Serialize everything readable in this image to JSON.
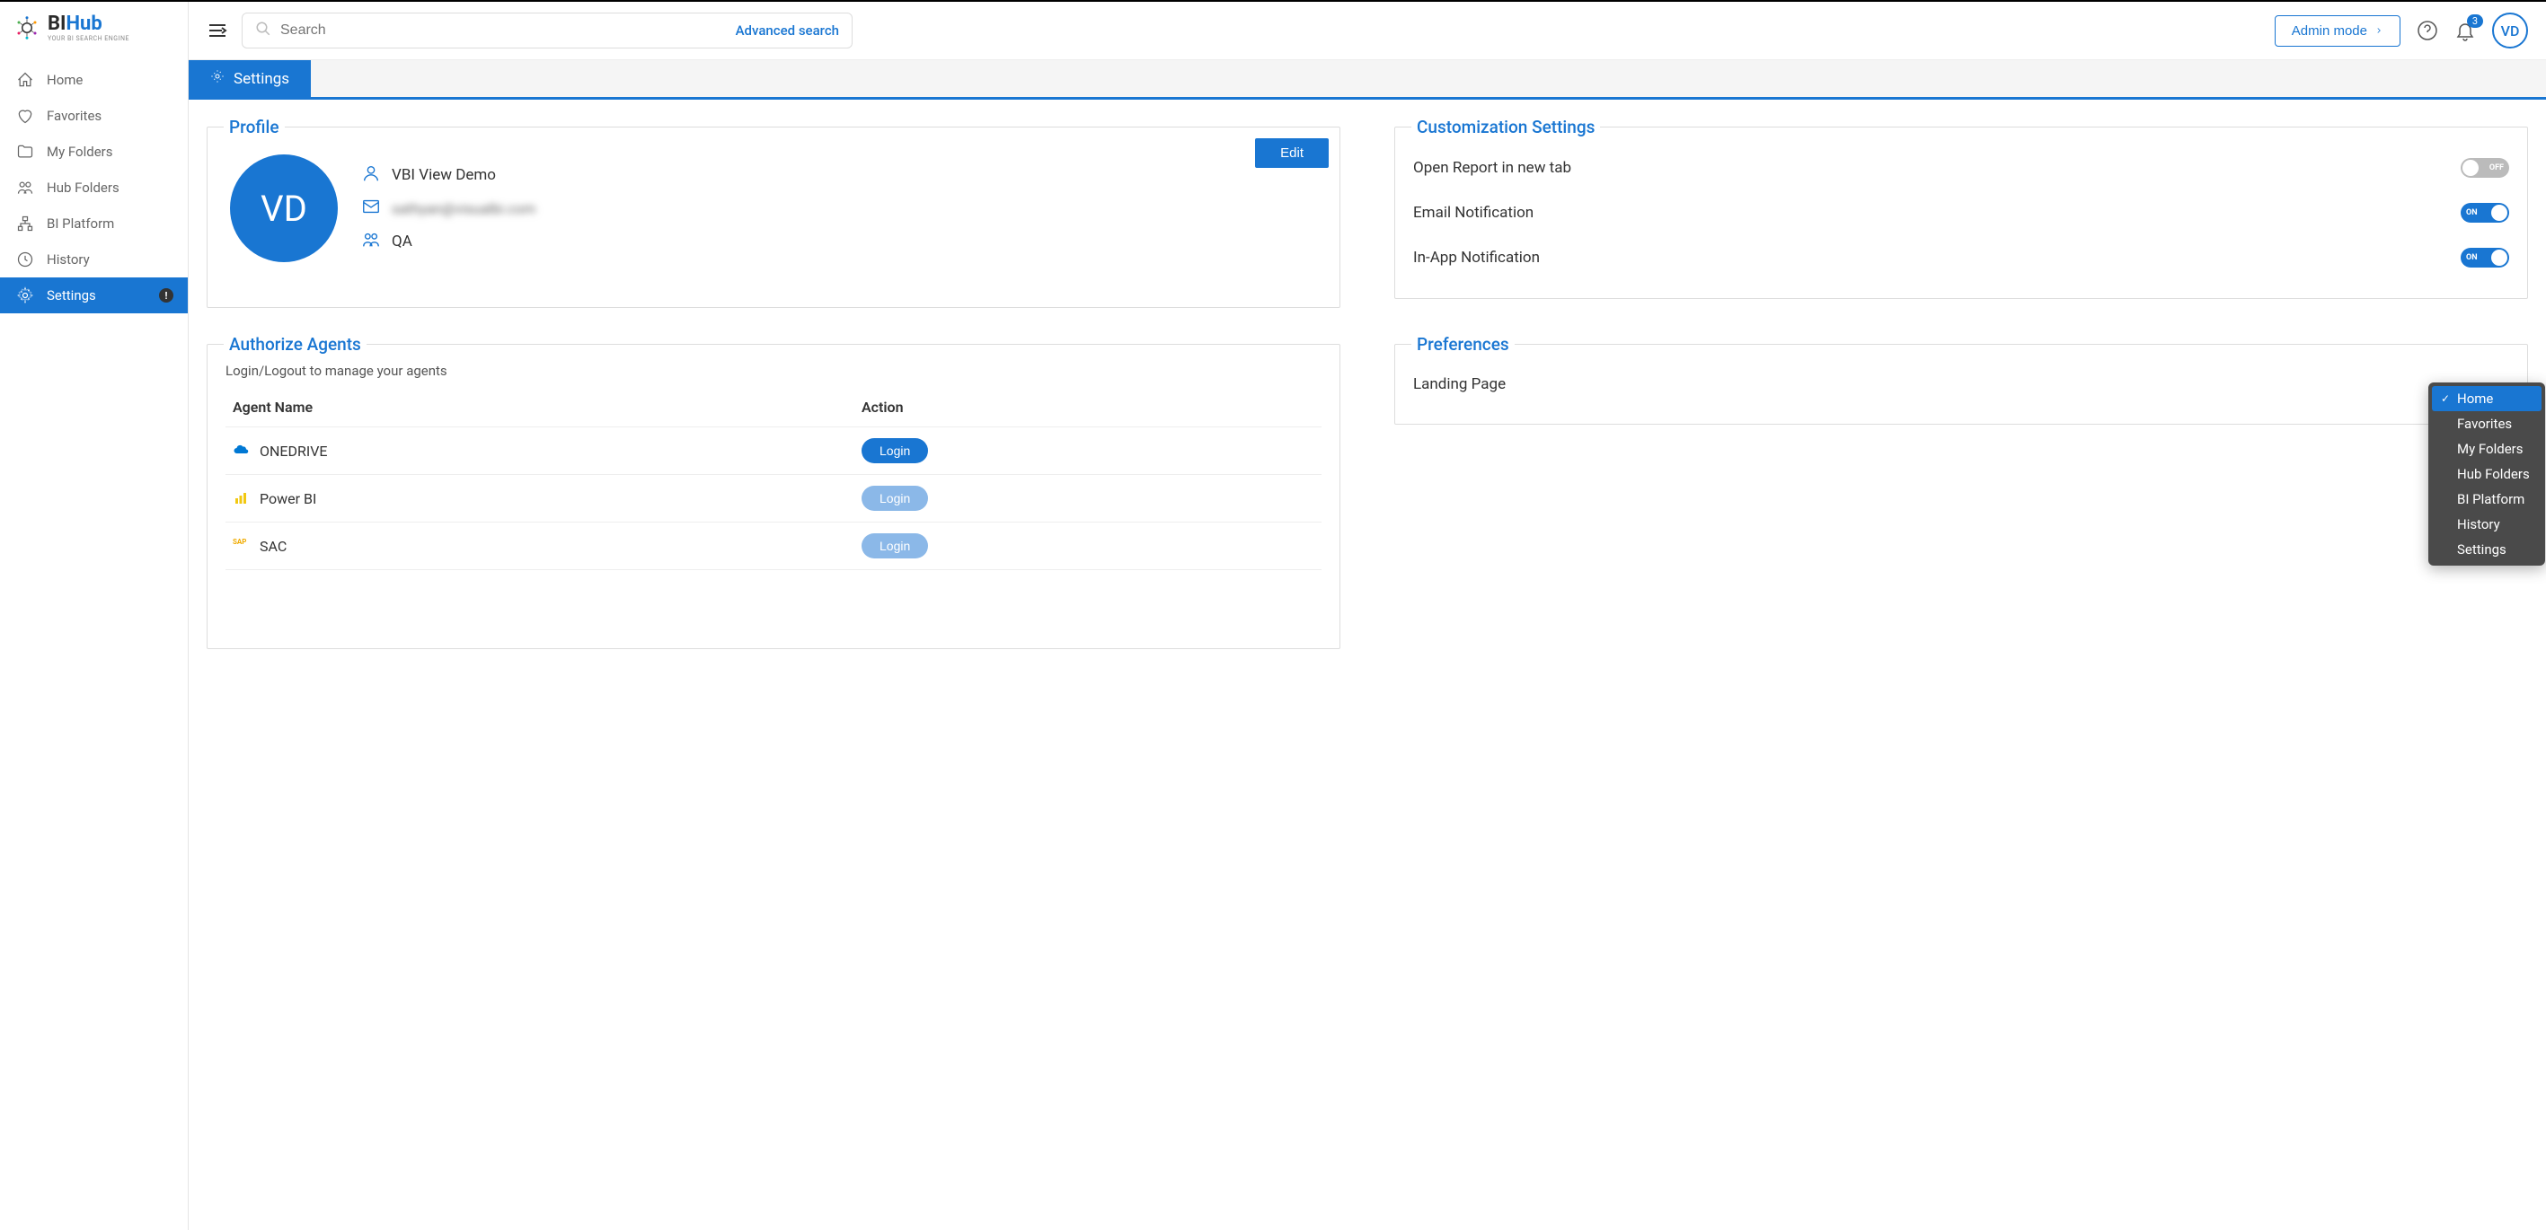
{
  "logo": {
    "main_a": "BI",
    "main_b": "Hub",
    "sub": "YOUR BI SEARCH ENGINE"
  },
  "nav": {
    "items": [
      {
        "label": "Home"
      },
      {
        "label": "Favorites"
      },
      {
        "label": "My Folders"
      },
      {
        "label": "Hub Folders"
      },
      {
        "label": "BI Platform"
      },
      {
        "label": "History"
      },
      {
        "label": "Settings"
      }
    ],
    "alert": "!"
  },
  "header": {
    "search_placeholder": "Search",
    "advanced": "Advanced search",
    "admin_mode": "Admin mode",
    "avatar": "VD",
    "badge": "3"
  },
  "tab": {
    "label": "Settings"
  },
  "profile": {
    "title": "Profile",
    "edit": "Edit",
    "avatar": "VD",
    "name": "VBI View Demo",
    "email": "sathyan@visualbi.com",
    "group": "QA"
  },
  "customization": {
    "title": "Customization Settings",
    "rows": [
      {
        "label": "Open Report in new tab",
        "state": "OFF"
      },
      {
        "label": "Email Notification",
        "state": "ON"
      },
      {
        "label": "In-App Notification",
        "state": "ON"
      }
    ]
  },
  "agents": {
    "title": "Authorize Agents",
    "subtitle": "Login/Logout to manage your agents",
    "col_name": "Agent Name",
    "col_action": "Action",
    "rows": [
      {
        "name": "ONEDRIVE",
        "action": "Login",
        "enabled": true
      },
      {
        "name": "Power BI",
        "action": "Login",
        "enabled": false
      },
      {
        "name": "SAC",
        "action": "Login",
        "enabled": false
      }
    ]
  },
  "prefs": {
    "title": "Preferences",
    "landing_label": "Landing Page",
    "options": [
      {
        "label": "Home",
        "selected": true
      },
      {
        "label": "Favorites",
        "selected": false
      },
      {
        "label": "My Folders",
        "selected": false
      },
      {
        "label": "Hub Folders",
        "selected": false
      },
      {
        "label": "BI Platform",
        "selected": false
      },
      {
        "label": "History",
        "selected": false
      },
      {
        "label": "Settings",
        "selected": false
      }
    ]
  }
}
